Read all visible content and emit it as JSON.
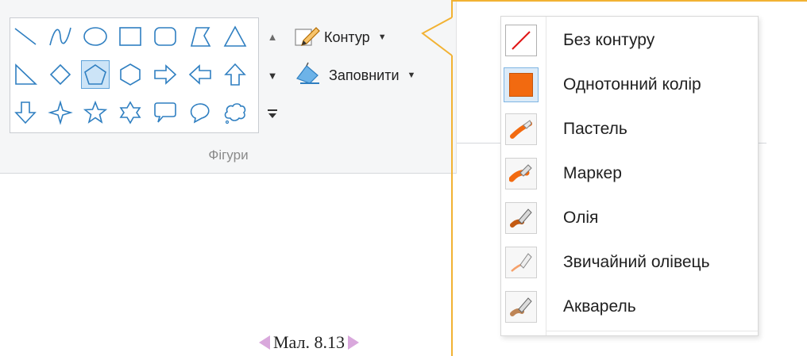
{
  "ribbon": {
    "group_label": "Фігури",
    "outline_label": "Контур",
    "fill_label": "Заповнити",
    "shapes": [
      "line-shape-icon",
      "curve-shape-icon",
      "oval-shape-icon",
      "rectangle-shape-icon",
      "rounded-rectangle-shape-icon",
      "polygon-shape-icon",
      "triangle-shape-icon",
      "right-triangle-shape-icon",
      "diamond-shape-icon",
      "pentagon-shape-icon",
      "hexagon-shape-icon",
      "right-arrow-shape-icon",
      "left-arrow-shape-icon",
      "up-arrow-shape-icon",
      "down-arrow-shape-icon",
      "four-point-star-shape-icon",
      "five-point-star-shape-icon",
      "six-point-star-shape-icon",
      "rounded-callout-shape-icon",
      "oval-callout-shape-icon",
      "cloud-callout-shape-icon"
    ],
    "selected_shape": "pentagon-shape-icon"
  },
  "menu": {
    "items": [
      {
        "label": "Без контуру",
        "icon": "no-outline-icon"
      },
      {
        "label": "Однотонний колір",
        "icon": "solid-color-icon"
      },
      {
        "label": "Пастель",
        "icon": "crayon-icon"
      },
      {
        "label": "Маркер",
        "icon": "marker-icon"
      },
      {
        "label": "Олія",
        "icon": "oil-brush-icon"
      },
      {
        "label": "Звичайний олівець",
        "icon": "natural-pencil-icon"
      },
      {
        "label": "Акварель",
        "icon": "watercolor-icon"
      }
    ],
    "selected_item": "Однотонний колір"
  },
  "caption": "Мал. 8.13",
  "colors": {
    "accent_orange": "#f26a10",
    "callout": "#f2b233",
    "selection_blue": "#cce4f7",
    "shape_stroke": "#2f7fc1"
  }
}
